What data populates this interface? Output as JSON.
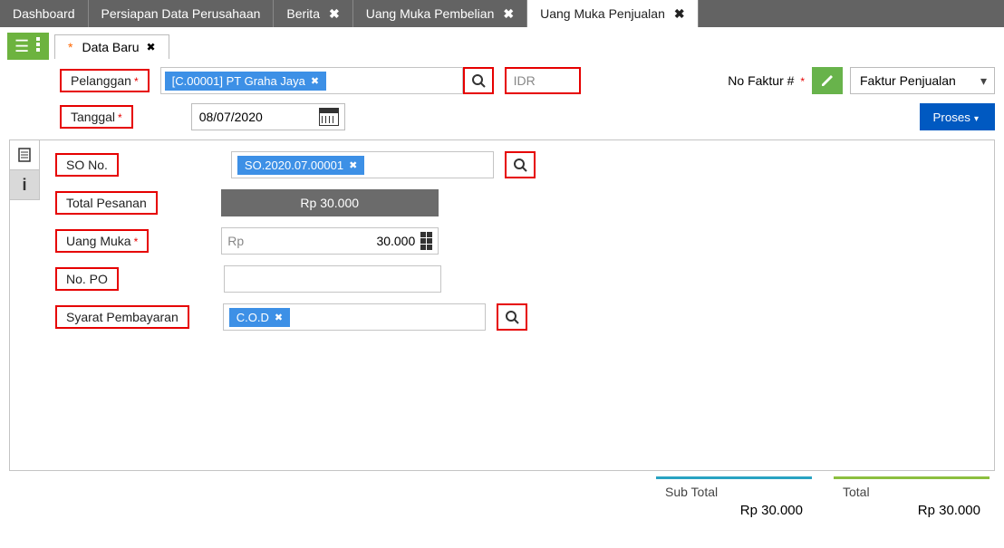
{
  "tabs": {
    "dashboard": "Dashboard",
    "persiapan": "Persiapan Data Perusahaan",
    "berita": "Berita",
    "uang_pembelian": "Uang Muka Pembelian",
    "uang_penjualan": "Uang Muka Penjualan"
  },
  "sub_tab": "Data Baru",
  "labels": {
    "pelanggan": "Pelanggan",
    "tanggal": "Tanggal",
    "so_no": "SO No.",
    "total_pesanan": "Total Pesanan",
    "uang_muka": "Uang Muka",
    "no_po": "No. PO",
    "syarat": "Syarat Pembayaran",
    "no_faktur": "No Faktur #",
    "sub_total": "Sub Total",
    "total": "Total"
  },
  "values": {
    "pelanggan_token": "[C.00001] PT Graha Jaya",
    "currency": "IDR",
    "faktur_select": "Faktur Penjualan",
    "tanggal": "08/07/2020",
    "so_token": "SO.2020.07.00001",
    "total_pesanan": "Rp 30.000",
    "uang_muka_prefix": "Rp",
    "uang_muka": "30.000",
    "syarat_token": "C.O.D",
    "sub_total": "Rp 30.000",
    "total": "Rp 30.000"
  },
  "buttons": {
    "proses": "Proses"
  },
  "glyphs": {
    "close": "✖",
    "x_small": "✖",
    "info": "i"
  }
}
